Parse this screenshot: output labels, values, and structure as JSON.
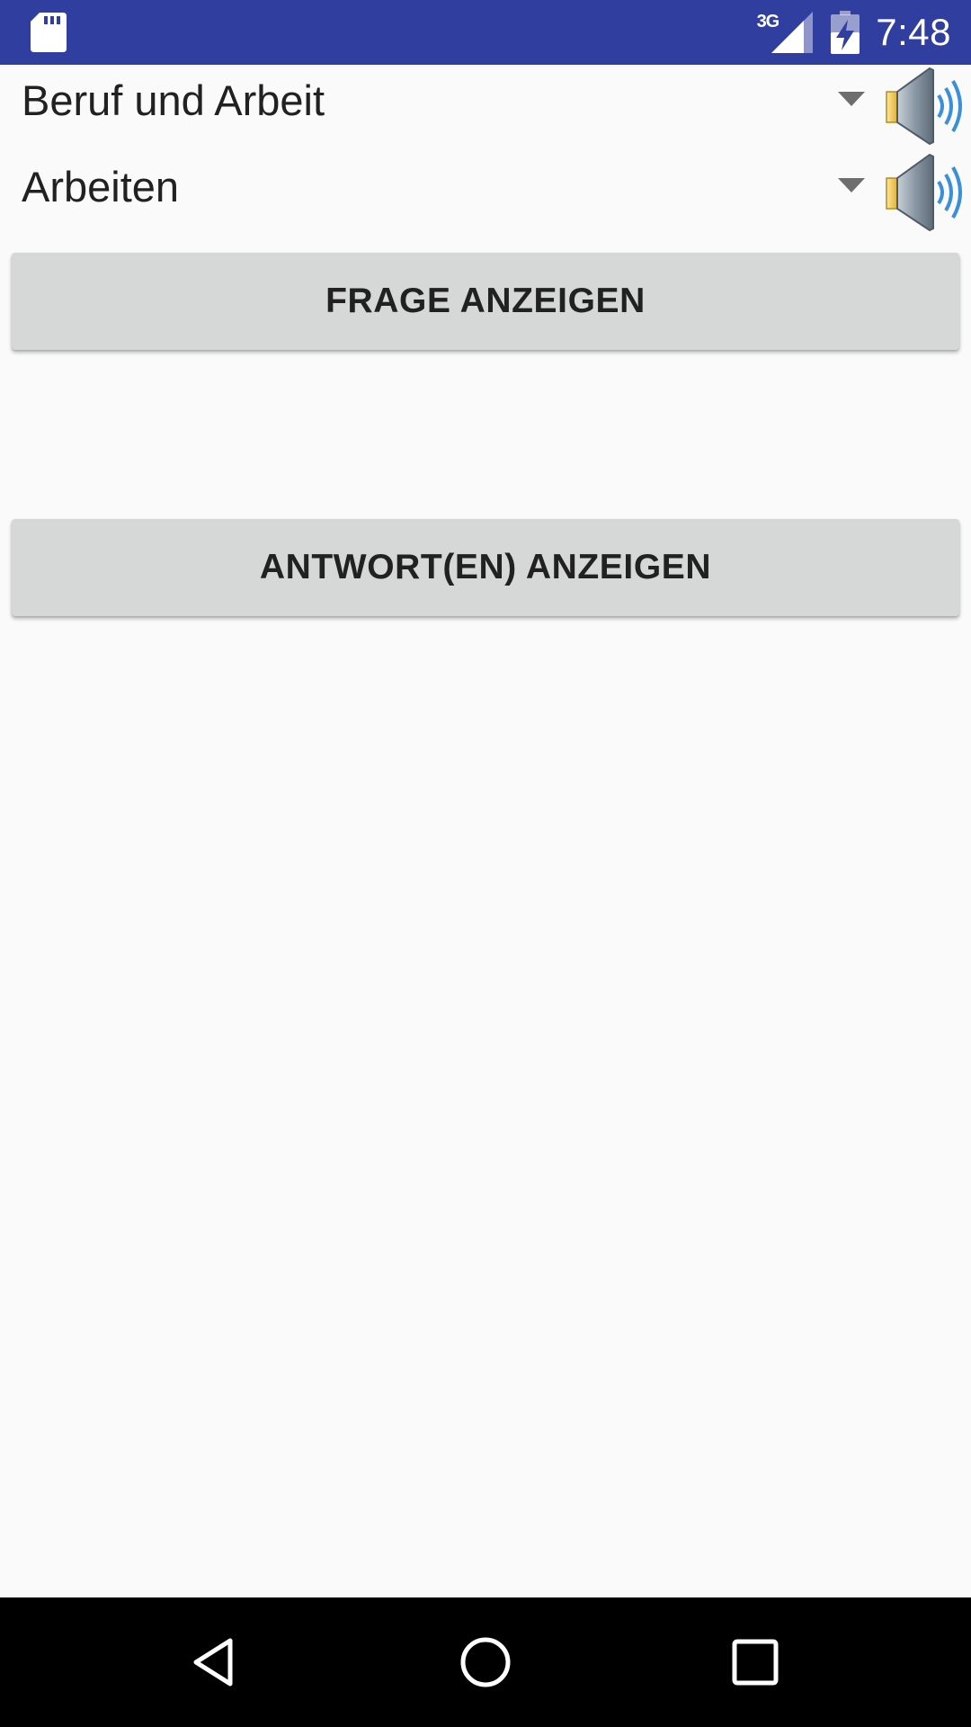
{
  "status_bar": {
    "background": "#303f9f",
    "sd_icon": "sd-card-icon",
    "network_type": "3G",
    "signal_icon": "cell-signal-icon",
    "battery_icon": "battery-charging-icon",
    "time": "7:48"
  },
  "selectors": {
    "category": {
      "value": "Beruf und Arbeit",
      "dropdown_icon": "dropdown-arrow-icon",
      "speaker_icon": "speaker-icon"
    },
    "subcategory": {
      "value": "Arbeiten",
      "dropdown_icon": "dropdown-arrow-icon",
      "speaker_icon": "speaker-icon"
    }
  },
  "buttons": {
    "show_question": "FRAGE ANZEIGEN",
    "show_answers": "ANTWORT(EN) ANZEIGEN"
  },
  "nav_bar": {
    "back_icon": "back-icon",
    "home_icon": "home-icon",
    "recents_icon": "recents-icon"
  },
  "colors": {
    "status_bar": "#303f9f",
    "background": "#fafafa",
    "button": "#d6d7d7",
    "text": "#212121",
    "nav_bar": "#000000"
  }
}
